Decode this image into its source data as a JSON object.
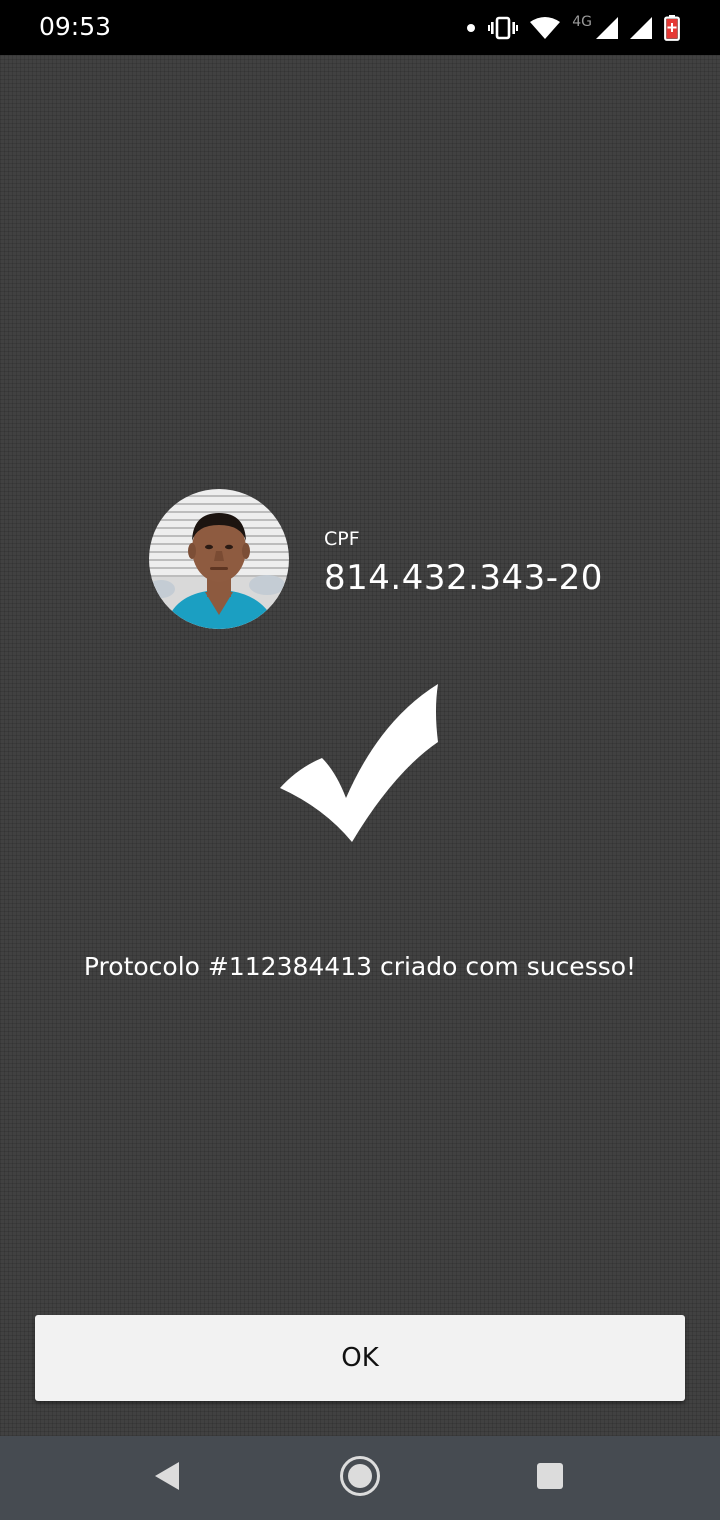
{
  "status_bar": {
    "time": "09:53",
    "network_type": "4G",
    "icons": [
      "notification-dot-icon",
      "vibrate-icon",
      "wifi-icon",
      "cell-signal-icon",
      "cell-signal-icon",
      "battery-low-icon"
    ]
  },
  "profile": {
    "avatar_icon": "user-photo",
    "cpf_label": "CPF",
    "cpf_value": "814.432.343-20"
  },
  "result": {
    "icon": "checkmark-icon",
    "message": "Protocolo #112384413 criado com sucesso!"
  },
  "actions": {
    "ok_label": "OK"
  },
  "nav_bar": {
    "buttons": [
      "back-icon",
      "home-icon",
      "recents-icon"
    ]
  },
  "colors": {
    "background": "#414141",
    "status_bar": "#000000",
    "nav_bar": "#464b51",
    "button": "#f2f2f2",
    "text": "#ffffff",
    "battery_alert": "#e53935"
  }
}
